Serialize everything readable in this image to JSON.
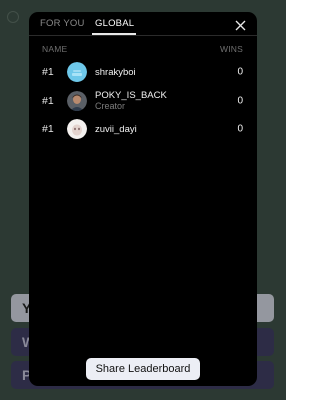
{
  "background": {
    "buttons": [
      "Y",
      "W",
      "P"
    ]
  },
  "modal": {
    "tabs": [
      {
        "label": "FOR YOU",
        "active": false
      },
      {
        "label": "GLOBAL",
        "active": true
      }
    ],
    "columns": {
      "name": "NAME",
      "wins": "WINS"
    },
    "rows": [
      {
        "rank": "#1",
        "username": "shrakyboi",
        "role": "",
        "wins": "0",
        "avatar": "light-blue-avatar"
      },
      {
        "rank": "#1",
        "username": "POKY_IS_BACK",
        "role": "Creator",
        "wins": "0",
        "avatar": "photo-avatar"
      },
      {
        "rank": "#1",
        "username": "zuvii_dayi",
        "role": "",
        "wins": "0",
        "avatar": "white-avatar"
      }
    ],
    "share_label": "Share Leaderboard"
  },
  "icons": {
    "close": "close-icon"
  },
  "colors": {
    "modal_bg": "#000000",
    "share_bg": "#eceef5",
    "accent_light": "#d9dbe8",
    "accent_purple": "#3b3760"
  }
}
